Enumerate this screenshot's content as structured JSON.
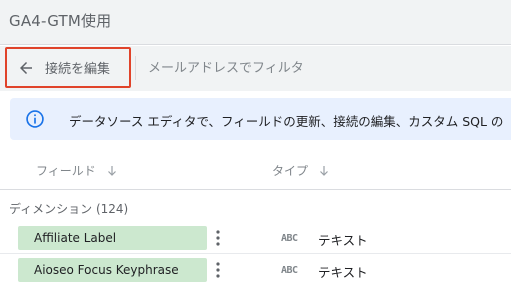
{
  "header": {
    "title": "GA4-GTM使用"
  },
  "toolbar": {
    "back_label": "接続を編集",
    "filter_placeholder": "メールアドレスでフィルタ"
  },
  "banner": {
    "text": "データソース エディタで、フィールドの更新、接続の編集、カスタム SQL の"
  },
  "columns": {
    "field": "フィールド",
    "type": "タイプ"
  },
  "section": {
    "dimensions_label": "ディメンション (124)"
  },
  "rows": [
    {
      "name": "Affiliate Label",
      "type_code": "ABC",
      "type_label": "テキスト"
    },
    {
      "name": "Aioseo Focus Keyphrase",
      "type_code": "ABC",
      "type_label": "テキスト"
    }
  ],
  "colors": {
    "highlight": "#e0432a",
    "chip_bg": "#cce8cf",
    "banner_bg": "#e8f0fe",
    "info_icon": "#1a73e8"
  },
  "icons": [
    "back-arrow-icon",
    "info-icon",
    "sort-down-icon",
    "more-vert-icon"
  ]
}
